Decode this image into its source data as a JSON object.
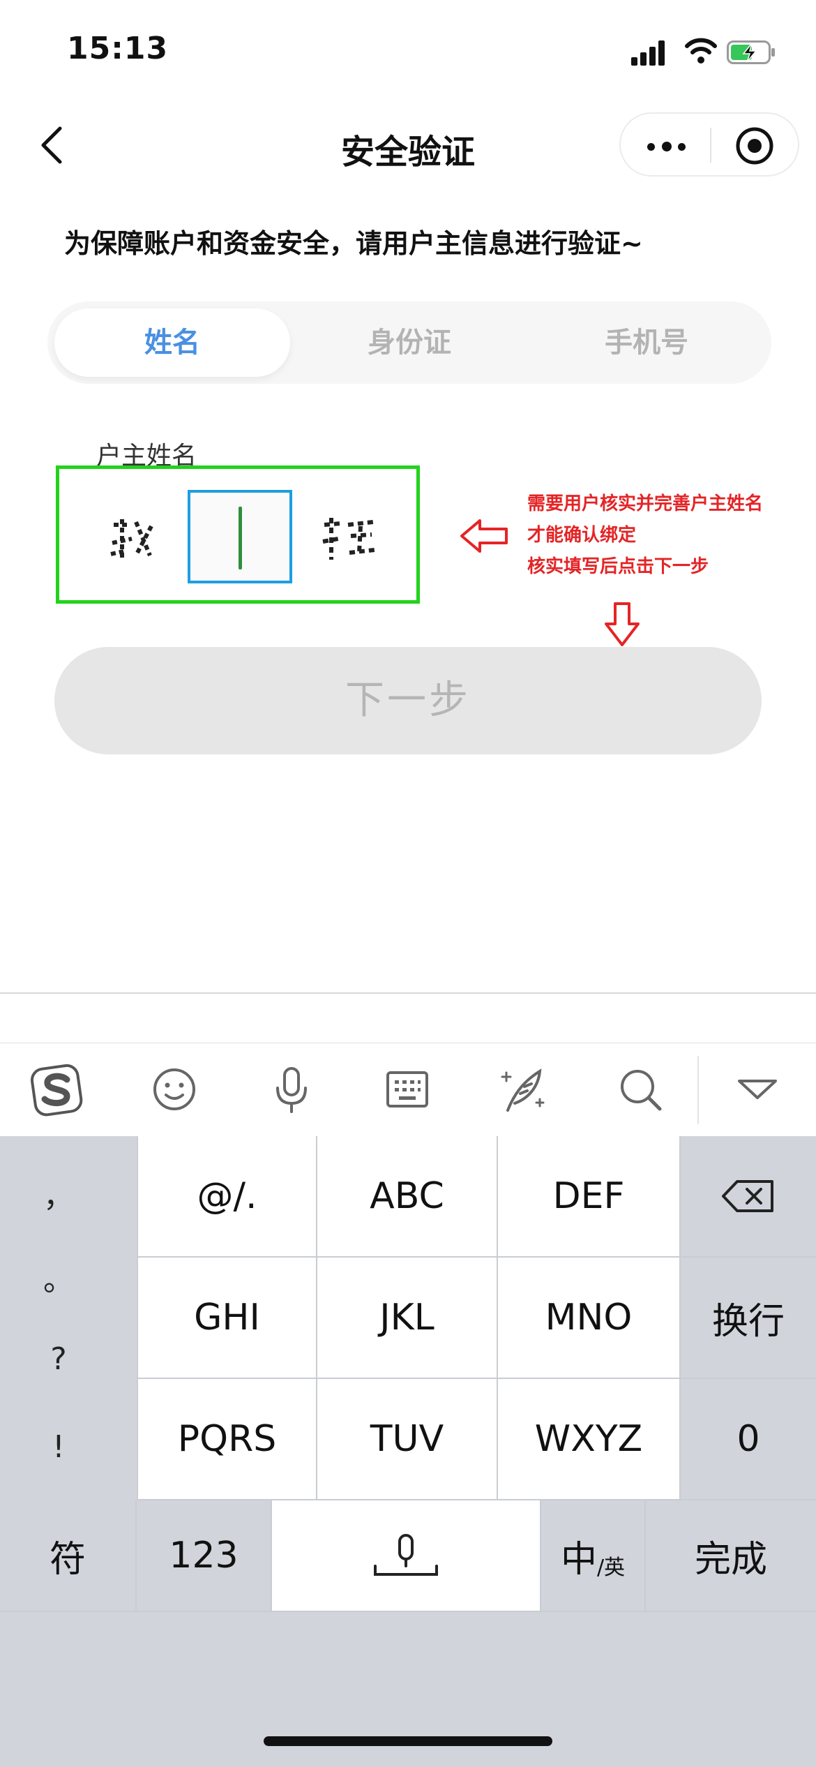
{
  "status_bar": {
    "time": "15:13"
  },
  "nav": {
    "title": "安全验证"
  },
  "notice": "为保障账户和资金安全，请用户主信息进行验证~",
  "tabs": [
    {
      "label": "姓名",
      "active": true
    },
    {
      "label": "身份证",
      "active": false
    },
    {
      "label": "手机号",
      "active": false
    }
  ],
  "form": {
    "label": "户主姓名",
    "button_label": "下一步"
  },
  "annotation": {
    "lines": [
      "需要用户核实并完善户主姓名",
      "才能确认绑定",
      "核实填写后点击下一步"
    ],
    "color": "#e42426"
  },
  "keyboard": {
    "punctuation": [
      "，",
      "。",
      "?",
      "!"
    ],
    "rows": [
      [
        "@/.",
        "ABC",
        "DEF"
      ],
      [
        "GHI",
        "JKL",
        "MNO"
      ],
      [
        "PQRS",
        "TUV",
        "WXYZ"
      ]
    ],
    "return_label": "换行",
    "zero_label": "0",
    "bottom": {
      "symbols": "符",
      "numbers": "123",
      "lang_main": "中",
      "lang_sub": "/英",
      "done": "完成"
    },
    "toolbar_icons": [
      "sogou-logo-icon",
      "emoji-icon",
      "microphone-icon",
      "keyboard-icon",
      "handwriting-icon",
      "search-icon",
      "collapse-icon"
    ]
  },
  "colors": {
    "accent_tab": "#4a90e2",
    "highlight_box": "#22d31c",
    "input_border": "#1e9ee0"
  }
}
